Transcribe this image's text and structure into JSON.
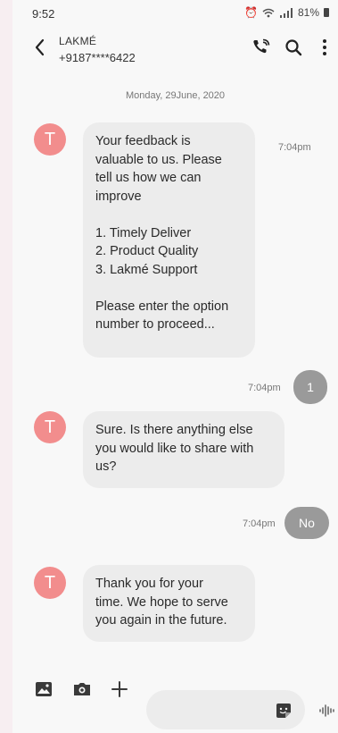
{
  "status_bar": {
    "time": "9:52",
    "battery": "81%"
  },
  "header": {
    "contact_name": "LAKMÉ",
    "contact_number": "+9187****6422"
  },
  "date_separator": "Monday, 29June, 2020",
  "messages": [
    {
      "direction": "incoming",
      "avatar_letter": "T",
      "text": "Your feedback is\nvaluable to us. Please\ntell us how we can\nimprove\n\n1. Timely Deliver\n2. Product Quality\n3. Lakmé Support\n\nPlease enter the option\nnumber to proceed...",
      "time": "7:04pm"
    },
    {
      "direction": "outgoing",
      "text": "1",
      "time": "7:04pm"
    },
    {
      "direction": "incoming",
      "avatar_letter": "T",
      "text": "Sure. Is there anything else\nyou would like to share with\nus?"
    },
    {
      "direction": "outgoing",
      "text": "No",
      "time": "7:04pm"
    },
    {
      "direction": "incoming",
      "avatar_letter": "T",
      "text": "Thank you for your\ntime. We hope to serve\nyou again in the future."
    }
  ],
  "icons": {
    "back": "back-arrow-icon",
    "call": "wifi-call-icon",
    "search": "search-icon",
    "more": "more-vertical-icon",
    "gallery": "image-icon",
    "camera": "camera-icon",
    "add": "plus-icon",
    "sticker": "sticker-icon",
    "voice": "voice-wave-icon"
  },
  "colors": {
    "avatar": "#f28d8d",
    "incoming_bubble": "#ececec",
    "outgoing_bubble": "#9a9a9a"
  }
}
